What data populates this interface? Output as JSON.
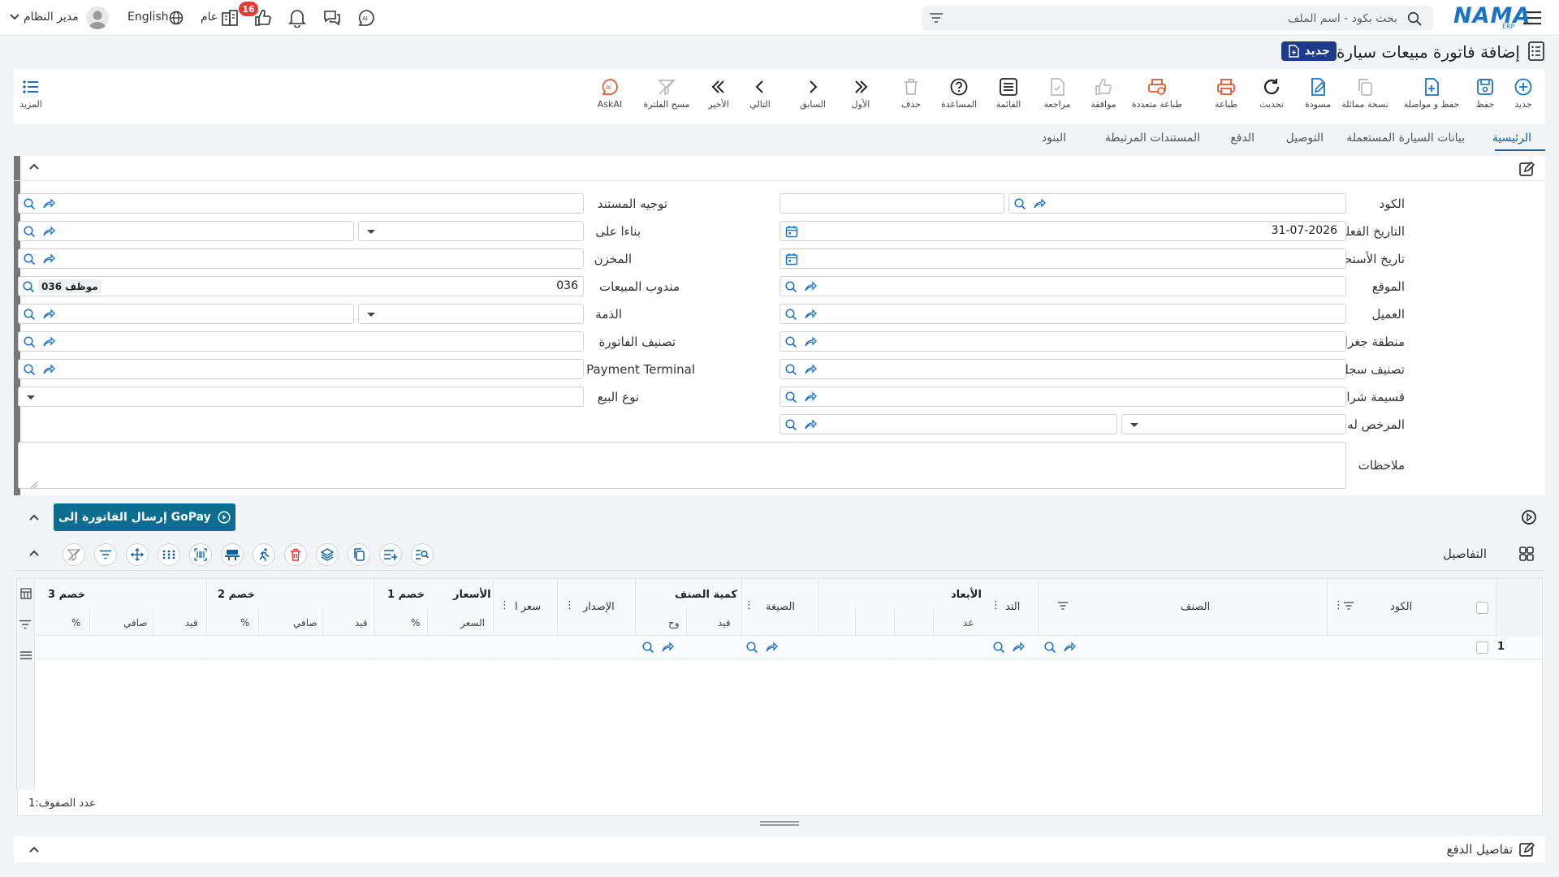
{
  "topbar": {
    "search_placeholder": "بحث بكود - اسم الملف",
    "logo_text": "NAMA",
    "logo_sub": "ERP",
    "language": "English",
    "branch": "عام",
    "notifications_count": "16",
    "user_name": "مدير النظام"
  },
  "page": {
    "title": "إضافة فاتورة مبيعات سيارة",
    "status_badge": "جديد"
  },
  "toolbar": {
    "new": "جديد",
    "save": "حفظ",
    "save_continue": "حفظ و مواصلة",
    "clone": "نسخة مماثلة",
    "draft": "مسودة",
    "refresh": "تحديث",
    "print": "طباعة",
    "multi_print": "طباعة متعددة",
    "approve": "موافقة",
    "review": "مراجعة",
    "list": "القائمة",
    "help": "المساعدة",
    "delete": "حذف",
    "first": "الأول",
    "previous": "السابق",
    "next": "التالي",
    "last": "الأخير",
    "clear_filter": "مسح الفلترة",
    "askai": "AskAI",
    "more": "المزيد"
  },
  "tabs": [
    "الرئيسية",
    "بيانات السيارة المستعملة",
    "التوصيل",
    "الدفع",
    "المستندات المرتبطة",
    "البنود"
  ],
  "form": {
    "right": {
      "code": "الكود",
      "actual_date": "التاريخ الفعلي",
      "actual_date_value": "31-07-2026",
      "due_date": "تاريخ الأستحقاق",
      "location": "الموقع",
      "customer": "العميل",
      "geo_region": "منطقة جغرافيه",
      "record_class": "تصنيف سجل",
      "purchase_voucher": "قسيمة شراء",
      "licensee": "المرخص له",
      "notes": "ملاحظات"
    },
    "left": {
      "doc_direction": "توجيه المستند",
      "based_on": "بناءا على",
      "warehouse": "المخزن",
      "sales_rep": "مندوب المبيعات",
      "sales_rep_code": "036",
      "sales_rep_name": "موظف 036",
      "liability": "الذمة",
      "invoice_class": "تصنيف الفاتورة",
      "payment_terminal": "Payment Terminal",
      "sale_type": "نوع البيع"
    }
  },
  "gopay": {
    "button": "إرسال الفاتورة إلى GoPay"
  },
  "details": {
    "title": "التفاصيل",
    "columns": {
      "code": "الكود",
      "item": "الصنف",
      "dimensions_group": "الأبعاد",
      "dim_sub1": "التد",
      "dim_sub2": "عد",
      "formula": "الصيغة",
      "item_qty_group": "كمية الصنف",
      "qty_sub1": "قيد",
      "qty_sub2": "وح",
      "release": "الإصدار",
      "prices_group": "الأسعار",
      "price_sub1": "سعر ا",
      "price_sub2": "السعر",
      "discount1_group": "خصم 1",
      "discount2_group": "خصم 2",
      "discount3_group": "خصم 3",
      "pct": "%",
      "entry": "قيد",
      "net": "صافي"
    },
    "row_number": "1",
    "row_count_label": "عدد الصفوف:",
    "row_count": "1"
  },
  "payment": {
    "title": "تفاصيل الدفع"
  }
}
